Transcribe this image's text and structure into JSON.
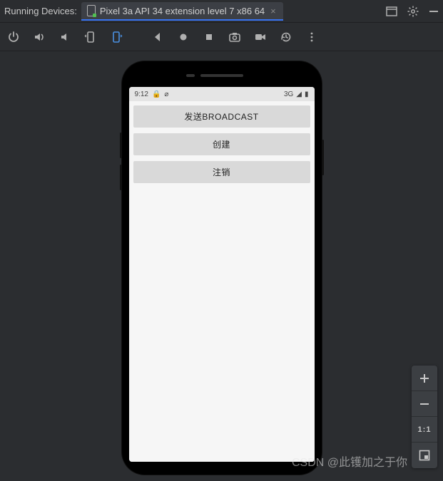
{
  "tabbar": {
    "running_label": "Running Devices:",
    "device_name": "Pixel 3a API 34 extension level 7 x86 64"
  },
  "statusbar": {
    "time": "9:12",
    "network": "3G"
  },
  "app": {
    "buttons": [
      "发送BROADCAST",
      "创建",
      "注销"
    ]
  },
  "zoom": {
    "ratio": "1:1"
  },
  "watermark": "CSDN @此镬加之于你"
}
